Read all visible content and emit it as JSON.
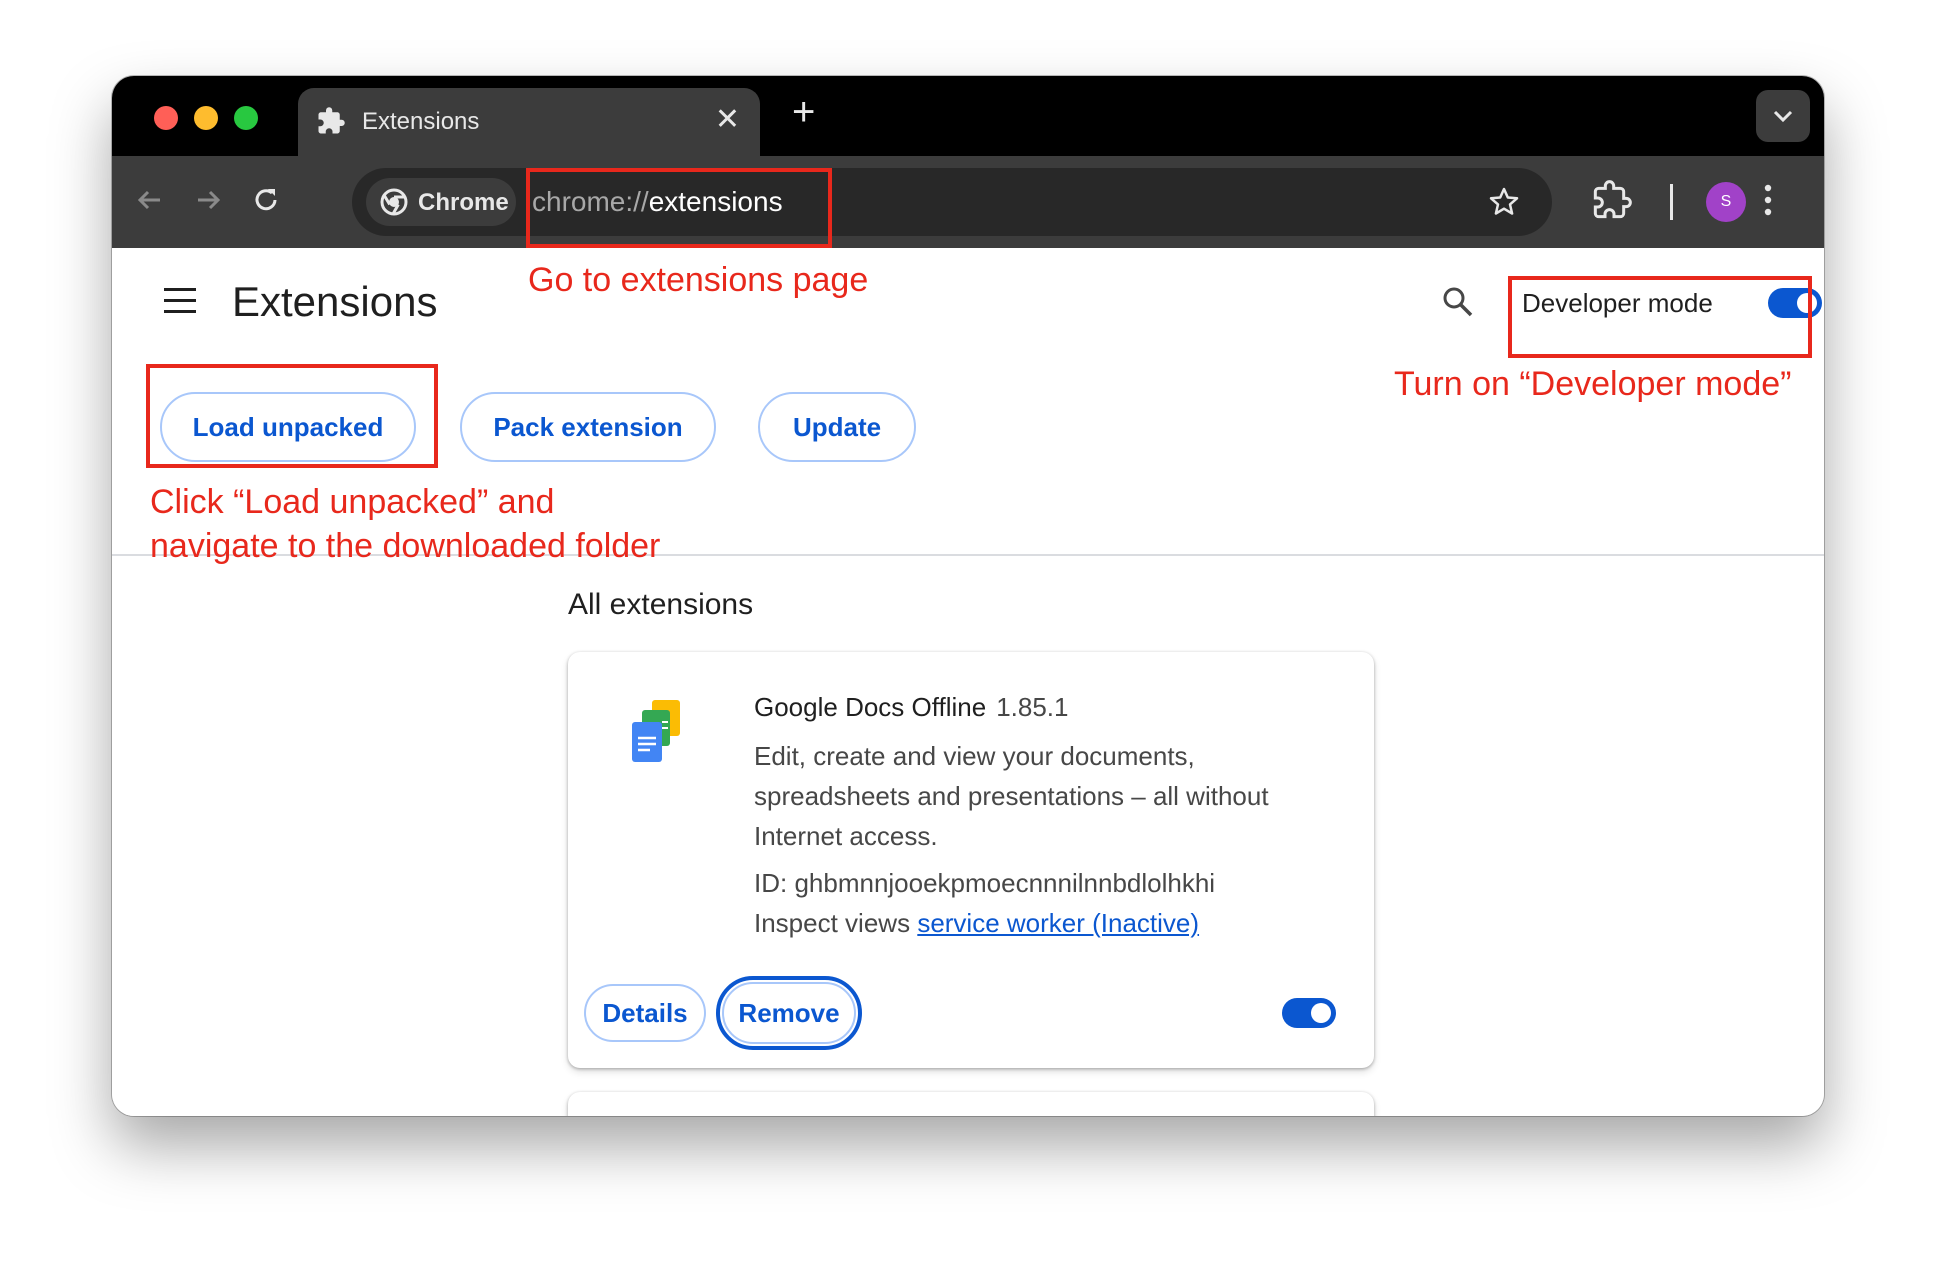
{
  "window": {
    "tab_title": "Extensions",
    "tab_close": "✕",
    "new_tab": "+"
  },
  "toolbar": {
    "chip_label": "Chrome",
    "url_scheme": "chrome://",
    "url_host": "extensions",
    "avatar_letter": "S"
  },
  "page": {
    "title": "Extensions",
    "developer_mode_label": "Developer mode",
    "developer_mode_on": true,
    "buttons": {
      "load_unpacked": "Load unpacked",
      "pack_extension": "Pack extension",
      "update": "Update"
    },
    "section_title": "All extensions"
  },
  "extension": {
    "name": "Google Docs Offline",
    "version": "1.85.1",
    "description": "Edit, create and view your documents, spreadsheets and presentations – all without Internet access.",
    "id_text": "ID: ghbmnnjooekpmoecnnnilnnbdlolhkhi",
    "inspect_label": "Inspect views",
    "inspect_link": "service worker (Inactive)",
    "details_button": "Details",
    "remove_button": "Remove",
    "enabled": true
  },
  "annotations": {
    "go_to_page": "Go to extensions page",
    "developer_mode": "Turn on “Developer mode”",
    "load_unpacked_line1": "Click “Load unpacked” and",
    "load_unpacked_line2": "navigate to the downloaded folder",
    "color": "#e8281c"
  },
  "colors": {
    "accent": "#0b57d0",
    "titlebar": "#000000",
    "toolbar": "#3c3c3c",
    "omnibox": "#282828",
    "avatar": "#a142c8"
  }
}
